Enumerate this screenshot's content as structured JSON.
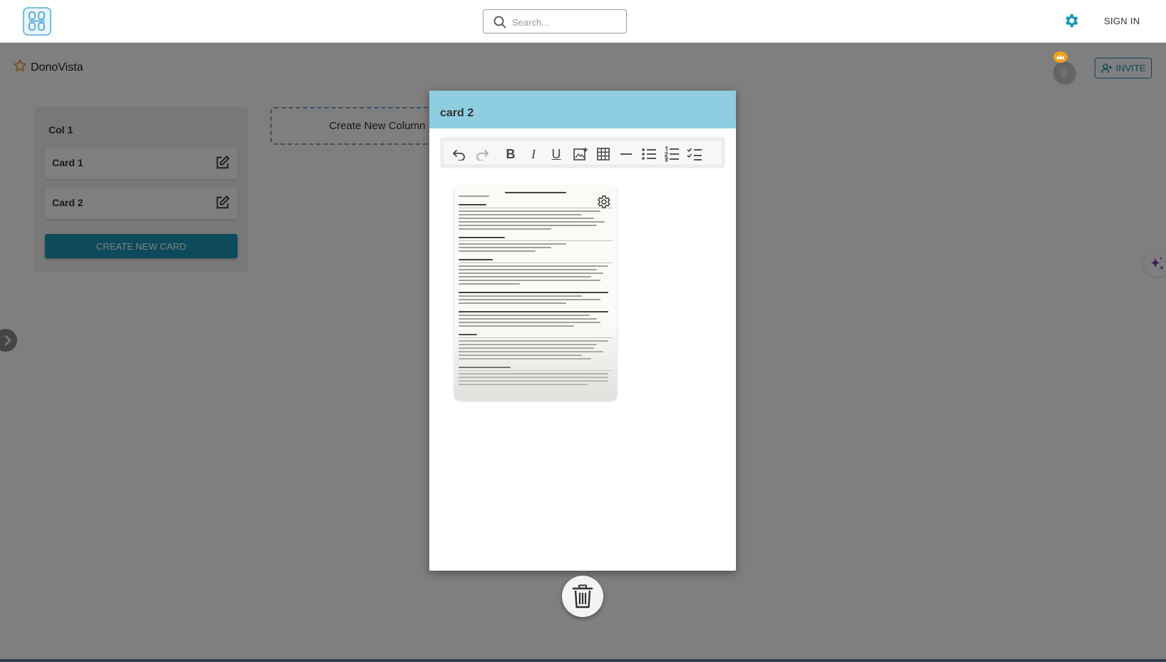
{
  "nav": {
    "search_placeholder": "Search...",
    "signin_label": "SIGN IN",
    "gear_color": "#1a95b8"
  },
  "board": {
    "title": "DonoVista",
    "avatar_initial": "g",
    "invite_label": "INVITE",
    "columns": [
      {
        "title": "Col 1",
        "cards": [
          {
            "title": "Card 1"
          },
          {
            "title": "Card 2"
          }
        ],
        "create_card_label": "CREATE NEW CARD"
      }
    ],
    "new_column_label": "Create New Column"
  },
  "modal": {
    "title": "card 2",
    "header_color": "#8fcde0",
    "toolbar": [
      "undo-icon",
      "redo-icon",
      "bold-icon",
      "italic-icon",
      "underline-icon",
      "image-icon",
      "table-icon",
      "horizontal-rule-icon",
      "bullet-list-icon",
      "numbered-list-icon",
      "checklist-icon"
    ],
    "toolbar_labels": {
      "bold": "B",
      "italic": "I",
      "underline": "U"
    },
    "attachment": "resume-image"
  },
  "colors": {
    "accent": "#1a95b8",
    "crown": "#f0a020",
    "star": "#e0a030"
  }
}
